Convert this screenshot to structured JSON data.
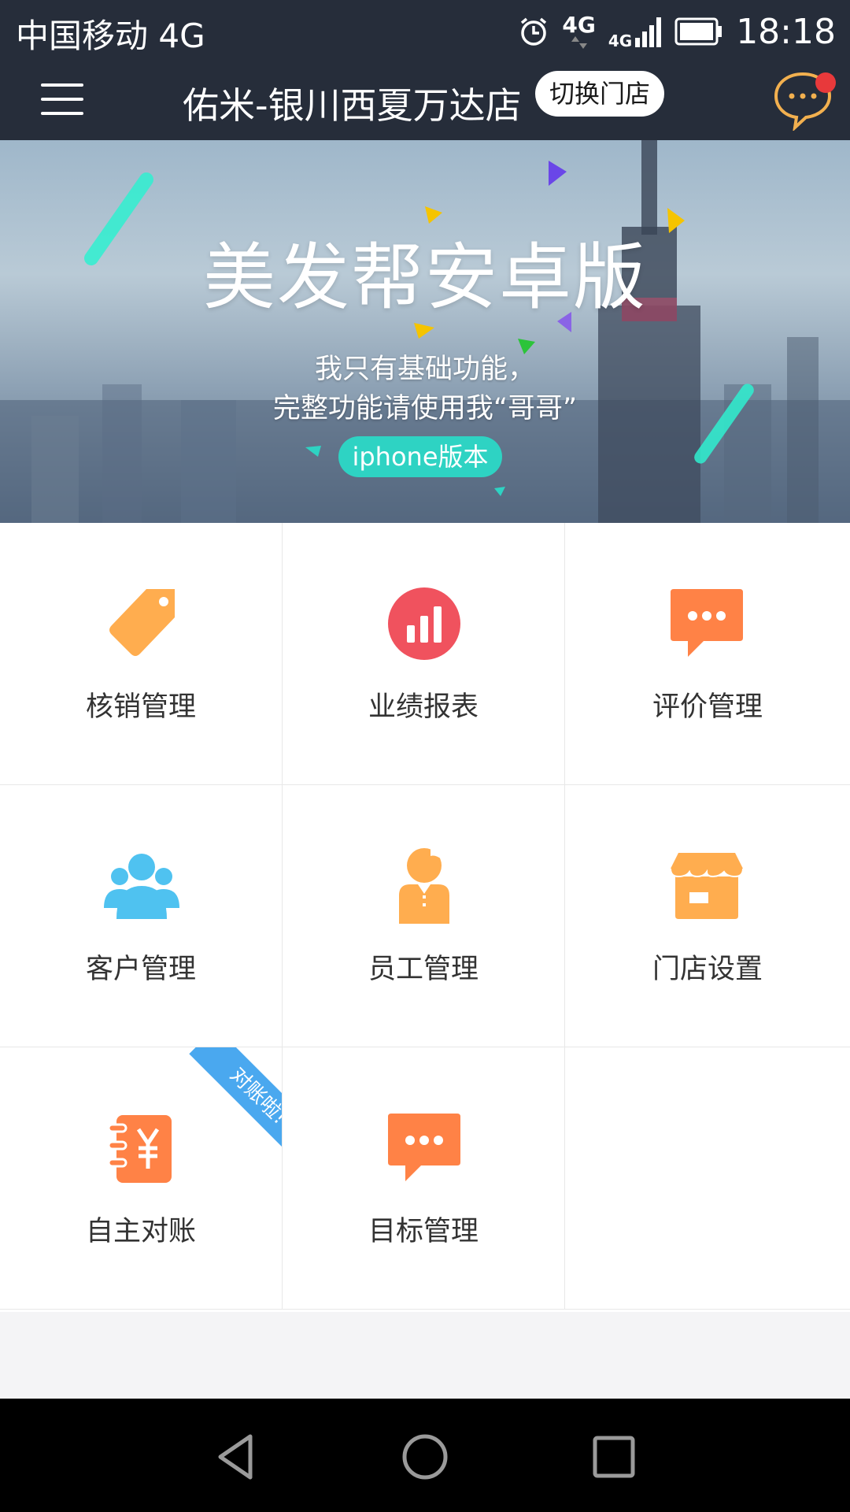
{
  "status_bar": {
    "carrier": "中国移动 4G",
    "network_1": "4G",
    "network_2": "4G",
    "time": "18:18"
  },
  "header": {
    "store_name": "佑米-银川西夏万达店",
    "switch_label": "切换门店"
  },
  "banner": {
    "title": "美发帮安卓版",
    "line1": "我只有基础功能，",
    "line2": "完整功能请使用我“哥哥”",
    "pill": "iphone版本"
  },
  "grid": {
    "items": [
      {
        "label": "核销管理",
        "icon": "tag-icon"
      },
      {
        "label": "业绩报表",
        "icon": "bar-chart-icon"
      },
      {
        "label": "评价管理",
        "icon": "comment-icon"
      },
      {
        "label": "客户管理",
        "icon": "customers-icon"
      },
      {
        "label": "员工管理",
        "icon": "staff-icon"
      },
      {
        "label": "门店设置",
        "icon": "store-icon"
      },
      {
        "label": "自主对账",
        "icon": "ledger-icon",
        "ribbon": "对账啦!"
      },
      {
        "label": "目标管理",
        "icon": "target-comment-icon"
      }
    ]
  },
  "colors": {
    "topbar": "#262d3a",
    "orange": "#ffad4f",
    "coral": "#ff8246",
    "red": "#f0525e",
    "blue": "#4fc2f0",
    "teal": "#2ed3c3",
    "ribbon": "#4aa8ef"
  }
}
